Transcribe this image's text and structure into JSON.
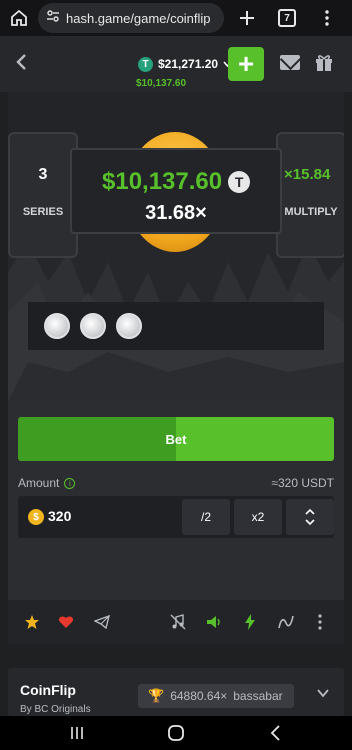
{
  "browser": {
    "url": "hash.game/game/coinflip",
    "tab_count": "7",
    "icons": [
      "home-icon",
      "site-settings-icon",
      "plus-icon",
      "tab-switcher-icon",
      "more-icon"
    ]
  },
  "header": {
    "balance_symbol": "T",
    "balance": "$21,271.20",
    "balance_change": "$10,137.60",
    "deposit_label": "+"
  },
  "game": {
    "series_value": "3",
    "series_label": "SERIES",
    "win_amount": "$10,137.60",
    "win_currency": "T",
    "win_multiplier": "31.68×",
    "multiply_value": "×15.84",
    "multiply_label": "MULTIPLY",
    "result_coins": [
      "coin-1",
      "coin-2",
      "coin-3"
    ]
  },
  "controls": {
    "bet_label": "Bet",
    "amount_label": "Amount",
    "amount_usdt": "≈320 USDT",
    "amount_value": "320",
    "amount_symbol": "$",
    "half_label": "/2",
    "double_label": "x2"
  },
  "toolbar": {
    "icons": [
      "star-icon",
      "heart-icon",
      "telegram-icon",
      "music-off-icon",
      "volume-icon",
      "lightning-icon",
      "graph-icon",
      "more-icon"
    ]
  },
  "info": {
    "title": "CoinFlip",
    "subtitle": "By BC Originals",
    "record": "64880.64×",
    "record_user": "bassabar"
  },
  "colors": {
    "accent": "#58c02b",
    "background": "#1f2022",
    "panel": "#2b2d31"
  }
}
